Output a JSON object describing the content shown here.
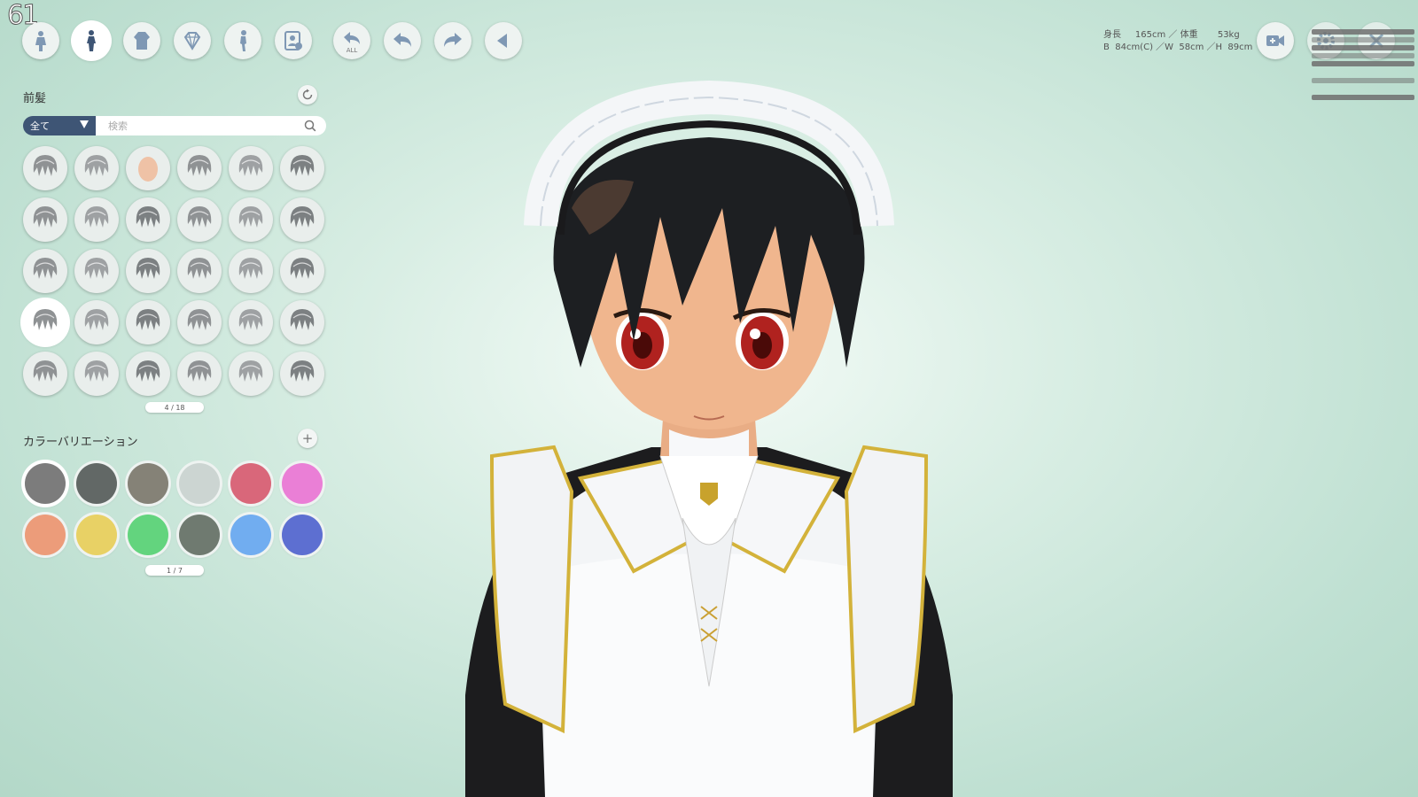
{
  "fps": "61",
  "toolbar": {
    "items": [
      {
        "icon": "body-type-icon"
      },
      {
        "icon": "body-icon",
        "active": true
      },
      {
        "icon": "clothing-icon"
      },
      {
        "icon": "accessory-icon"
      },
      {
        "icon": "pose-icon"
      },
      {
        "icon": "character-card-icon"
      },
      {
        "icon": "undo-all-icon",
        "label": "ALL"
      },
      {
        "icon": "undo-icon"
      },
      {
        "icon": "redo-icon"
      },
      {
        "icon": "collapse-icon"
      }
    ]
  },
  "hair_section": {
    "title": "前髪",
    "filter_value": "全て",
    "search_placeholder": "検索",
    "selected_index": 18,
    "pager": "4 / 18"
  },
  "color_section": {
    "title": "カラーバリエーション",
    "swatches": [
      "#7c7c7c",
      "#626866",
      "#858277",
      "#ccd5d2",
      "#d9677a",
      "#ea7fd6",
      "#ec9c7a",
      "#e8d165",
      "#63d47e",
      "#6f7a70",
      "#71adf0",
      "#5d6fd1"
    ],
    "selected_index": 0,
    "pager": "1 / 7"
  },
  "stats": {
    "line1": "身長     165cm ／ 体重       53kg",
    "line2": "B  84cm(C) ／W  58cm ／H  89cm"
  },
  "colors": {
    "filter_bg": "#3e5575",
    "bg_light": "#f4fbf7",
    "bg_dark": "#b3d8c8"
  }
}
